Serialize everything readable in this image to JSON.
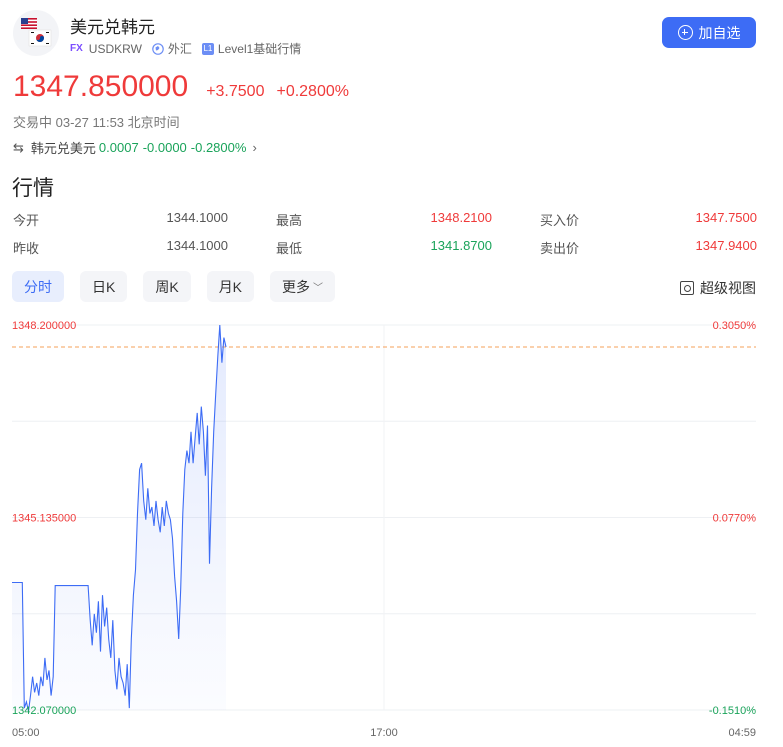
{
  "header": {
    "title": "美元兑韩元",
    "badge": "FX",
    "code": "USDKRW",
    "market": "外汇",
    "level_badge": "L1",
    "level": "Level1基础行情",
    "add_label": "加自选"
  },
  "quote": {
    "price": "1347.850000",
    "change": "+3.7500",
    "change_pct": "+0.2800%",
    "status": "交易中 03-27 11:53 北京时间"
  },
  "inverse": {
    "label": "韩元兑美元",
    "price": "0.0007",
    "change": "-0.0000",
    "change_pct": "-0.2800%"
  },
  "section_title": "行情",
  "stats": {
    "open_label": "今开",
    "open": "1344.1000",
    "prev_label": "昨收",
    "prev": "1344.1000",
    "high_label": "最高",
    "high": "1348.2100",
    "low_label": "最低",
    "low": "1341.8700",
    "bid_label": "买入价",
    "bid": "1347.7500",
    "ask_label": "卖出价",
    "ask": "1347.9400"
  },
  "tabs": [
    "分时",
    "日K",
    "周K",
    "月K",
    "更多"
  ],
  "super_view": "超级视图",
  "colors": {
    "up": "#ef3a3a",
    "down": "#1aa35a",
    "accent": "#3d6cf5",
    "line": "#3d6cf5",
    "ref_line": "#f5a05a"
  },
  "chart_data": {
    "type": "line",
    "x_ticks": [
      "05:00",
      "17:00",
      "04:59"
    ],
    "y_left_labels": [
      "1348.200000",
      "1345.135000",
      "1342.070000"
    ],
    "y_right_labels": [
      "0.3050%",
      "0.0770%",
      "-0.1510%"
    ],
    "ylim": [
      1342.07,
      1348.2
    ],
    "reference_value": 1344.1,
    "current_value": 1347.85,
    "grid": true,
    "series": [
      {
        "values": [
          1344.1,
          1344.1,
          1344.1,
          1344.1,
          1344.1,
          1344.1,
          1342.1,
          1342.2,
          1342.05,
          1342.3,
          1342.6,
          1342.35,
          1342.5,
          1342.3,
          1342.6,
          1342.45,
          1342.9,
          1342.55,
          1342.7,
          1342.3,
          1342.6,
          1344.05,
          1344.05,
          1344.05,
          1344.05,
          1344.05,
          1344.05,
          1344.05,
          1344.05,
          1344.05,
          1344.05,
          1344.05,
          1344.05,
          1344.05,
          1344.05,
          1344.05,
          1344.05,
          1344.05,
          1343.5,
          1343.1,
          1343.6,
          1343.3,
          1343.8,
          1343.0,
          1343.9,
          1343.4,
          1343.7,
          1343.2,
          1342.9,
          1343.5,
          1342.7,
          1342.4,
          1342.9,
          1342.6,
          1342.5,
          1342.3,
          1342.8,
          1342.1,
          1343.2,
          1343.9,
          1344.3,
          1345.2,
          1345.9,
          1346.0,
          1345.4,
          1345.1,
          1345.6,
          1345.2,
          1345.3,
          1345.0,
          1345.4,
          1345.1,
          1344.9,
          1345.3,
          1345.0,
          1345.4,
          1345.2,
          1345.1,
          1344.8,
          1344.2,
          1343.8,
          1343.2,
          1344.0,
          1345.2,
          1345.9,
          1346.2,
          1346.0,
          1346.5,
          1346.0,
          1346.4,
          1346.8,
          1346.3,
          1346.9,
          1346.5,
          1345.8,
          1346.6,
          1344.4,
          1345.6,
          1346.5,
          1347.1,
          1347.7,
          1348.2,
          1347.6,
          1348.0,
          1347.85
        ]
      }
    ]
  }
}
